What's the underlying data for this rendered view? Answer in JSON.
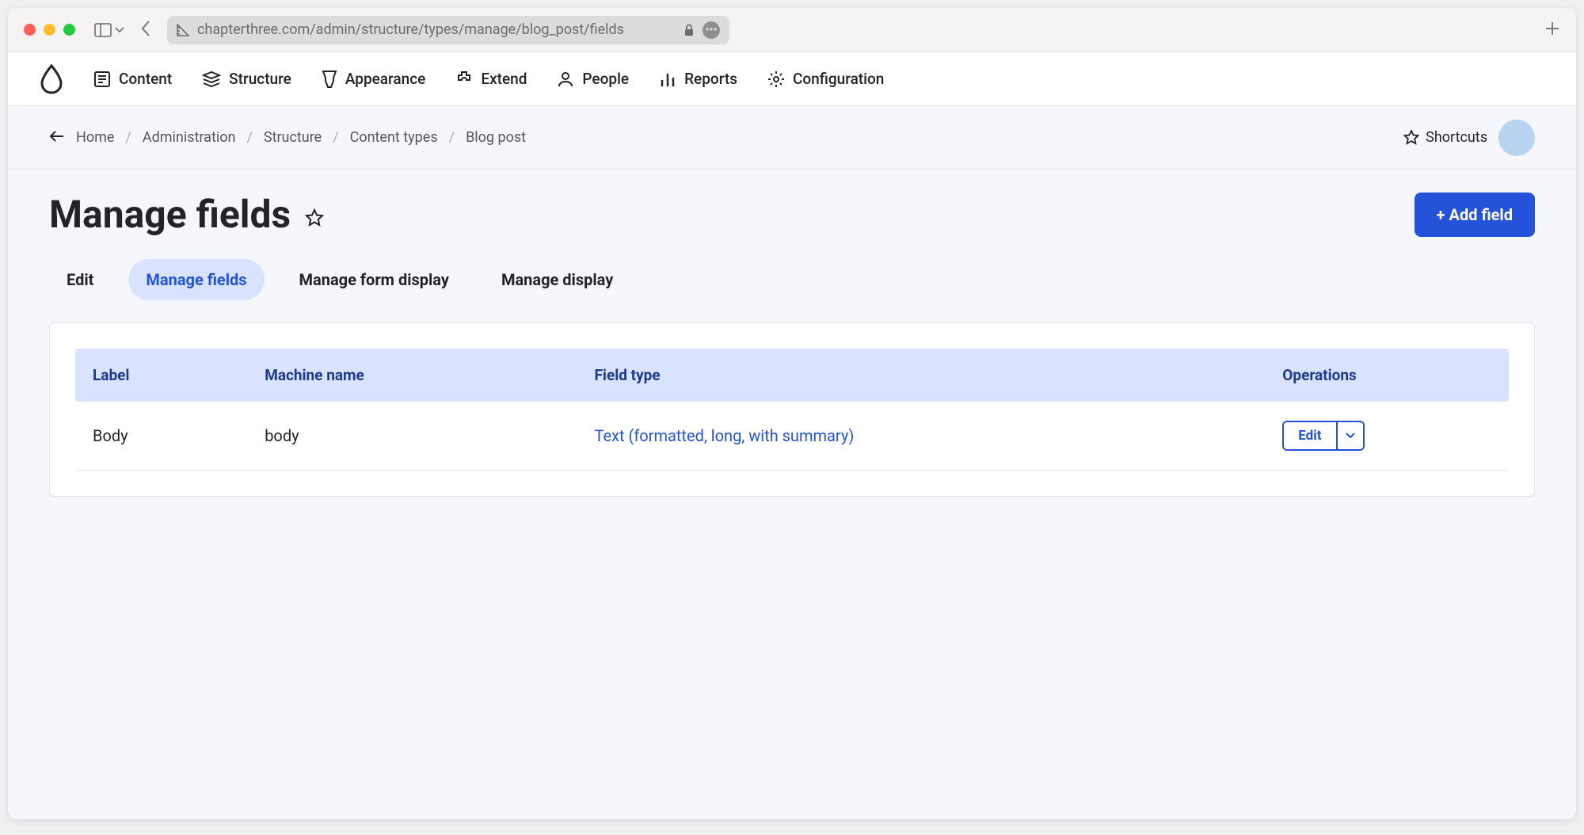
{
  "browser": {
    "url": "chapterthree.com/admin/structure/types/manage/blog_post/fields"
  },
  "toolbar": {
    "items": [
      {
        "label": "Content"
      },
      {
        "label": "Structure"
      },
      {
        "label": "Appearance"
      },
      {
        "label": "Extend"
      },
      {
        "label": "People"
      },
      {
        "label": "Reports"
      },
      {
        "label": "Configuration"
      }
    ]
  },
  "breadcrumb": {
    "items": [
      {
        "label": "Home"
      },
      {
        "label": "Administration"
      },
      {
        "label": "Structure"
      },
      {
        "label": "Content types"
      },
      {
        "label": "Blog post"
      }
    ]
  },
  "secondary": {
    "shortcuts": "Shortcuts"
  },
  "page": {
    "title": "Manage fields",
    "add_field": "+ Add field"
  },
  "tabs": [
    {
      "label": "Edit",
      "active": false
    },
    {
      "label": "Manage fields",
      "active": true
    },
    {
      "label": "Manage form display",
      "active": false
    },
    {
      "label": "Manage display",
      "active": false
    }
  ],
  "table": {
    "headers": {
      "label": "Label",
      "machine": "Machine name",
      "type": "Field type",
      "ops": "Operations"
    },
    "rows": [
      {
        "label": "Body",
        "machine": "body",
        "type": "Text (formatted, long, with summary)",
        "edit": "Edit"
      }
    ]
  }
}
